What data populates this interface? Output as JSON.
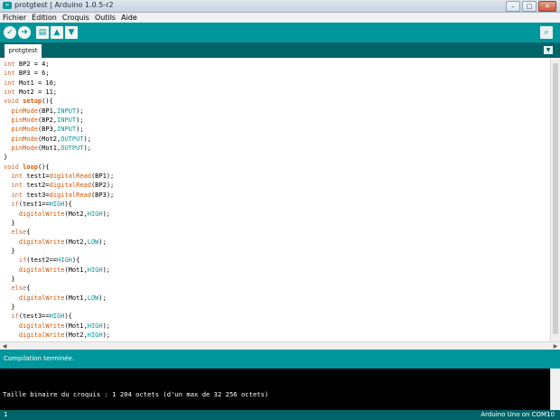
{
  "window": {
    "title": "protgtest | Arduino 1.0.5-r2",
    "app_icon": "arduino-icon",
    "buttons": [
      "minimize",
      "maximize",
      "close"
    ]
  },
  "menu": [
    "Fichier",
    "Édition",
    "Croquis",
    "Outils",
    "Aide"
  ],
  "toolbar": {
    "buttons": [
      {
        "name": "verify-button",
        "icon": "check-icon",
        "glyph": "✓"
      },
      {
        "name": "upload-button",
        "icon": "arrow-right-icon",
        "glyph": "➜"
      },
      {
        "name": "new-button",
        "icon": "new-file-icon",
        "glyph": "▤"
      },
      {
        "name": "open-button",
        "icon": "open-arrow-up-icon",
        "glyph": "▲"
      },
      {
        "name": "save-button",
        "icon": "save-arrow-down-icon",
        "glyph": "▼"
      }
    ],
    "serial_monitor_icon": "magnifier-icon"
  },
  "tabs": [
    {
      "label": "protgtest"
    }
  ],
  "editor": {
    "lines": [
      "int BP2 = 4;",
      "int BP3 = 6;",
      "int Mot1 = 10;",
      "int Mot2 = 11;",
      "void setup(){",
      "  pinMode(BP1,INPUT);",
      "  pinMode(BP2,INPUT);",
      "  pinMode(BP3,INPUT);",
      "  pinMode(Mot2,OUTPUT);",
      "  pinMode(Mot1,OUTPUT);",
      "}",
      "void loop(){",
      "  int test1=digitalRead(BP1);",
      "  int test2=digitalRead(BP2);",
      "  int test3=digitalRead(BP3);",
      "  if(test1==HIGH){",
      "    digitalWrite(Mot2,HIGH);",
      "  }",
      "  else{",
      "    digitalWrite(Mot2,LOW);",
      "  }",
      "    if(test2==HIGH){",
      "    digitalWrite(Mot1,HIGH);",
      "  }",
      "  else{",
      "    digitalWrite(Mot1,LOW);",
      "  }",
      "  if(test3==HIGH){",
      "    digitalWrite(Mot1,HIGH);",
      "    digitalWrite(Mot2,HIGH);"
    ]
  },
  "status": {
    "message": "Compilation terminée."
  },
  "console": {
    "output": "Taille binaire du croquis : 1 204 octets (d'un max de 32 256 octets)"
  },
  "footer": {
    "line": "1",
    "board": "Arduino Uno on COM10"
  },
  "colors": {
    "teal": "#00979c",
    "dark_teal": "#006468",
    "keyword": "#cc6633",
    "constant": "#00979c"
  }
}
